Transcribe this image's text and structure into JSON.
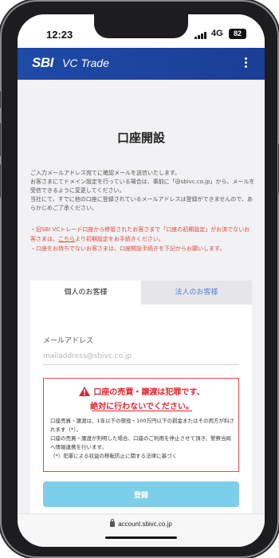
{
  "status_bar": {
    "time": "12:23",
    "network": "4G",
    "battery": "82"
  },
  "header": {
    "logo_sbi": "SBI",
    "logo_vc": "VC Trade",
    "menu_icon": "more-vert-icon"
  },
  "page": {
    "title": "口座開設",
    "intro": [
      "ご入力メールアドレス宛てに確認メールを送信いたします。",
      "お客さまにてドメイン設定を行っている場合は、事前に「@sbivc.co.jp」から、メールを受信できるように変更してください。",
      "当社にて、すでに他の口座に登録されているメールアドレスは登録ができませんので、あらかじめご了承ください。"
    ],
    "notice_1_before": "・旧SBI VCトレード口座から移管されたお客さまで「口座の初期設定」がお済でないお客さまは、",
    "notice_1_link": "こちら",
    "notice_1_after": "より初期設定をお手続きください。",
    "notice_2": "・口座をお持ちでないお客さまは、口座開設手続きを下記からお願いします。"
  },
  "tabs": {
    "individual": "個人のお客様",
    "corporate": "法人のお客様"
  },
  "form": {
    "email_label": "メールアドレス",
    "email_placeholder": "mailaddress@sbivc.co.jp",
    "submit_label": "登録"
  },
  "warning": {
    "icon": "warning-triangle-icon",
    "line1": "口座の売買・譲渡は犯罪です、",
    "line2": "絶対に行わないでください。",
    "body": [
      "口座売買・譲渡は、1年以下の懲役・100万円以下の罰金またはその両方が科されます（*）。",
      "口座の売買・譲渡が判明した場合、口座のご利用を停止させて頂き、警察当局へ情報連携を行います。",
      "（*）犯罪による収益の移転防止に関する法律に基づく"
    ],
    "color": "#e0262e"
  },
  "browser": {
    "url": "account.sbivc.co.jp"
  },
  "colors": {
    "header": "#1e4aa8",
    "button": "#7ccfe8",
    "notice": "#e0463f"
  }
}
